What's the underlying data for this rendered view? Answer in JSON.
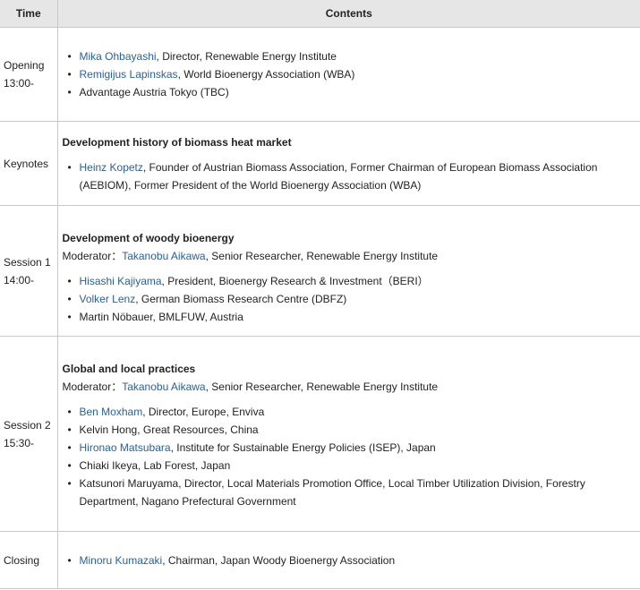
{
  "headers": {
    "time": "Time",
    "contents": "Contents"
  },
  "rows": [
    {
      "time_label": "Opening",
      "time_value": "13:00-",
      "items": [
        {
          "name": "Mika Ohbayashi",
          "rest": ", Director, Renewable Energy Institute"
        },
        {
          "name": "Remigijus Lapinskas",
          "rest": ", World Bioenergy Association (WBA)"
        },
        {
          "text": "Advantage Austria Tokyo (TBC)"
        }
      ]
    },
    {
      "time_label": "Keynotes",
      "title": "Development history of biomass heat market",
      "items": [
        {
          "name": "Heinz Kopetz",
          "rest": ", Founder of Austrian Biomass Association, Former Chairman of European Biomass Association (AEBIOM), Former President of the World Bioenergy Association (WBA)"
        }
      ]
    },
    {
      "time_label": "Session 1",
      "time_value": "14:00-",
      "title": "Development of woody bioenergy",
      "moderator_label": "Moderator：",
      "moderator_name": "Takanobu Aikawa",
      "moderator_rest": ", Senior Researcher, Renewable Energy Institute",
      "items": [
        {
          "name": "Hisashi Kajiyama",
          "rest": ", President, Bioenergy Research & Investment（BERI）"
        },
        {
          "name": "Volker Lenz",
          "rest": ", German Biomass Research Centre (DBFZ)"
        },
        {
          "text": "Martin Nöbauer, BMLFUW, Austria"
        }
      ]
    },
    {
      "time_label": "Session 2",
      "time_value": "15:30-",
      "title": "Global and local practices",
      "moderator_label": "Moderator：",
      "moderator_name": "Takanobu Aikawa",
      "moderator_rest": ", Senior Researcher, Renewable Energy Institute",
      "items": [
        {
          "name": "Ben Moxham",
          "rest": ", Director, Europe, Enviva"
        },
        {
          "text": "Kelvin Hong, Great Resources, China"
        },
        {
          "name": "Hironao Matsubara",
          "rest": ", Institute for Sustainable Energy Policies (ISEP), Japan"
        },
        {
          "text": "Chiaki Ikeya, Lab Forest, Japan"
        },
        {
          "text": "Katsunori Maruyama, Director, Local Materials Promotion Office, Local Timber Utilization Division, Forestry Department, Nagano Prefectural Government"
        }
      ]
    },
    {
      "time_label": "Closing",
      "items": [
        {
          "name": "Minoru Kumazaki",
          "rest": ", Chairman, Japan Woody Bioenergy Association"
        }
      ]
    }
  ]
}
